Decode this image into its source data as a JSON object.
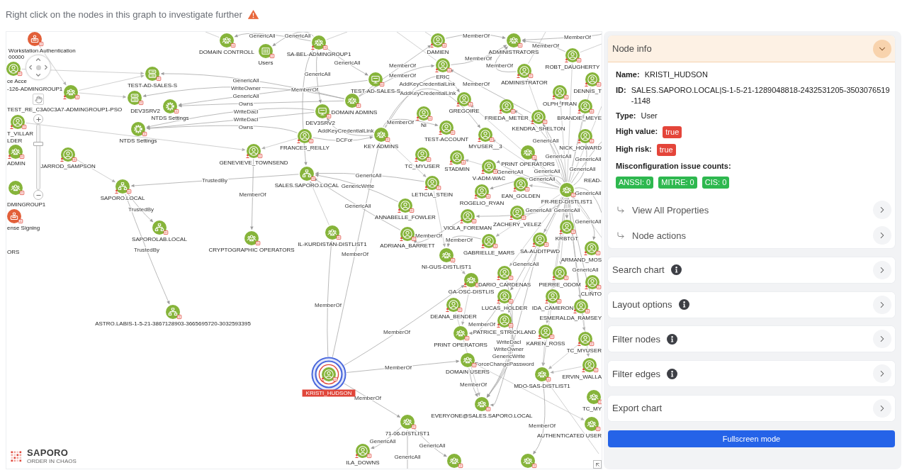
{
  "hint": {
    "text": "Right click on the nodes in this graph to investigate further"
  },
  "graph": {
    "nodes": [
      {
        "label": "Workstation Authentication",
        "kind": "policy",
        "color": "#e2603a",
        "alert": false,
        "selected": false
      },
      {
        "label": "DOMAIN CONTROLL",
        "kind": "group",
        "color": "#86b43a",
        "alert": false,
        "selected": false
      },
      {
        "label": "SA-BEL-ADMINGROUP1",
        "kind": "group",
        "color": "#86b43a",
        "alert": true,
        "selected": false
      },
      {
        "label": "DAMIEN",
        "kind": "user",
        "color": "#86b43a",
        "alert": true,
        "selected": false
      },
      {
        "label": "ADMINISTRATORS",
        "kind": "group",
        "color": "#86b43a",
        "alert": false,
        "selected": false
      },
      {
        "label": "Users",
        "kind": "container",
        "color": "#86b43a",
        "alert": false,
        "selected": false
      },
      {
        "label": "ROBT_DAUGHERTY",
        "kind": "user",
        "color": "#86b43a",
        "alert": true,
        "selected": false
      },
      {
        "label": "ERIC",
        "kind": "user",
        "color": "#86b43a",
        "alert": true,
        "selected": false
      },
      {
        "label": "ce Acce",
        "kind": "user",
        "color": "#86b43a",
        "alert": false,
        "selected": false
      },
      {
        "label": "TEST-AD-SALES-S",
        "kind": "server",
        "color": "#86b43a",
        "alert": false,
        "selected": false
      },
      {
        "label": "ADMINISTRATOR",
        "kind": "user",
        "color": "#86b43a",
        "alert": true,
        "selected": false
      },
      {
        "label": "TEST-AD-SALES-S",
        "kind": "computer",
        "color": "#86b43a",
        "alert": false,
        "selected": false
      },
      {
        "label": "DENNIS_T",
        "kind": "user",
        "color": "#86b43a",
        "alert": true,
        "selected": false
      },
      {
        "label": "OLPH_FRAN",
        "kind": "user",
        "color": "#86b43a",
        "alert": true,
        "selected": false
      },
      {
        "label": "TEST_RE_C3A0C3A7-ADMINGROUP1-PSO",
        "kind": "group",
        "color": "#86b43a",
        "alert": true,
        "selected": false
      },
      {
        "label": "DEV3SRV2",
        "kind": "server",
        "color": "#86b43a",
        "alert": false,
        "selected": false
      },
      {
        "label": "DOMAIN ADMINS",
        "kind": "group",
        "color": "#86b43a",
        "alert": false,
        "selected": false
      },
      {
        "label": "GREGOIRE",
        "kind": "user",
        "color": "#86b43a",
        "alert": true,
        "selected": false
      },
      {
        "label": "NTDS Settings",
        "kind": "settings",
        "color": "#86b43a",
        "alert": false,
        "selected": false
      },
      {
        "label": "FRIEDA_METER",
        "kind": "user",
        "color": "#86b43a",
        "alert": true,
        "selected": false
      },
      {
        "label": "BRANDIE_MEYE",
        "kind": "user",
        "color": "#86b43a",
        "alert": true,
        "selected": false
      },
      {
        "label": "DEV3SRV2",
        "kind": "computer",
        "color": "#86b43a",
        "alert": false,
        "selected": false
      },
      {
        "label": "NI",
        "kind": "user",
        "color": "#86b43a",
        "alert": true,
        "selected": false
      },
      {
        "label": "KENDRA_SHELTON",
        "kind": "user",
        "color": "#86b43a",
        "alert": true,
        "selected": false
      },
      {
        "label": "T_VILLAR",
        "kind": "user",
        "color": "#86b43a",
        "alert": true,
        "selected": false
      },
      {
        "label": "NTDS Settings",
        "kind": "settings",
        "color": "#86b43a",
        "alert": false,
        "selected": false
      },
      {
        "label": "TEST-ACCOUNT",
        "kind": "user",
        "color": "#86b43a",
        "alert": true,
        "selected": false
      },
      {
        "label": "FRANCES_REILLY",
        "kind": "user",
        "color": "#86b43a",
        "alert": true,
        "selected": false
      },
      {
        "label": "KEY ADMINS",
        "kind": "group",
        "color": "#86b43a",
        "alert": false,
        "selected": false
      },
      {
        "label": "MYUSER__3",
        "kind": "user",
        "color": "#86b43a",
        "alert": true,
        "selected": false
      },
      {
        "label": "NICK_HOWARD",
        "kind": "user",
        "color": "#86b43a",
        "alert": true,
        "selected": false
      },
      {
        "label": "ADMIN",
        "kind": "group",
        "color": "#86b43a",
        "alert": true,
        "selected": false
      },
      {
        "label": "GENEVIEVE_TOWNSEND",
        "kind": "user",
        "color": "#86b43a",
        "alert": true,
        "selected": false
      },
      {
        "label": "JARROD_SAMPSON",
        "kind": "user",
        "color": "#86b43a",
        "alert": true,
        "selected": false
      },
      {
        "label": "TC_MYUSER",
        "kind": "user",
        "color": "#86b43a",
        "alert": true,
        "selected": false
      },
      {
        "label": "PRINT OPERATORS",
        "kind": "group",
        "color": "#86b43a",
        "alert": false,
        "selected": false
      },
      {
        "label": "STADMIN",
        "kind": "user",
        "color": "#86b43a",
        "alert": true,
        "selected": false
      },
      {
        "label": "V-ADM-WAC",
        "kind": "user",
        "color": "#86b43a",
        "alert": true,
        "selected": false
      },
      {
        "label": "SALES.SAPORO.LOCAL",
        "kind": "domain",
        "color": "#86b43a",
        "alert": false,
        "selected": false
      },
      {
        "label": "LETICIA_STEIN",
        "kind": "user",
        "color": "#86b43a",
        "alert": true,
        "selected": false
      },
      {
        "label": "SAPORO.LOCAL",
        "kind": "domain",
        "color": "#86b43a",
        "alert": true,
        "selected": false
      },
      {
        "label": "EAN_GOLDEN",
        "kind": "user",
        "color": "#86b43a",
        "alert": true,
        "selected": false
      },
      {
        "label": "DMINGROUP1",
        "kind": "group",
        "color": "#86b43a",
        "alert": false,
        "selected": false
      },
      {
        "label": "ROGELIO_RYAN",
        "kind": "user",
        "color": "#86b43a",
        "alert": true,
        "selected": false
      },
      {
        "label": "FR-RED-DISTLIST1",
        "kind": "group",
        "color": "#86b43a",
        "alert": false,
        "selected": false
      },
      {
        "label": "ANNABELLE_FOWLER",
        "kind": "user",
        "color": "#86b43a",
        "alert": true,
        "selected": false
      },
      {
        "label": "ZACHERY_VELEZ",
        "kind": "user",
        "color": "#86b43a",
        "alert": true,
        "selected": false
      },
      {
        "label": "ense Signing",
        "kind": "policy",
        "color": "#e2603a",
        "alert": false,
        "selected": false
      },
      {
        "label": "VIOLA_FOREMAN",
        "kind": "user",
        "color": "#86b43a",
        "alert": true,
        "selected": false
      },
      {
        "label": "SAPOROLAB.LOCAL",
        "kind": "domain",
        "color": "#86b43a",
        "alert": false,
        "selected": false
      },
      {
        "label": "KRBTGT",
        "kind": "user",
        "color": "#86b43a",
        "alert": true,
        "selected": false
      },
      {
        "label": "IL-KURDISTAN-DISTLIST1",
        "kind": "group",
        "color": "#86b43a",
        "alert": false,
        "selected": false
      },
      {
        "label": "ADRIANA_BARRETT",
        "kind": "user",
        "color": "#86b43a",
        "alert": true,
        "selected": false
      },
      {
        "label": "CRYPTOGRAPHIC OPERATORS",
        "kind": "group",
        "color": "#86b43a",
        "alert": false,
        "selected": false
      },
      {
        "label": "GABRIELLE_MARS",
        "kind": "user",
        "color": "#86b43a",
        "alert": true,
        "selected": false
      },
      {
        "label": "SA-AUDITPWD",
        "kind": "user",
        "color": "#86b43a",
        "alert": true,
        "selected": false
      },
      {
        "label": "ARMAND_MOS",
        "kind": "user",
        "color": "#86b43a",
        "alert": true,
        "selected": false
      },
      {
        "label": "NI-GUS-DISTLIST1",
        "kind": "group",
        "color": "#86b43a",
        "alert": false,
        "selected": false
      },
      {
        "label": "DARIO_CARDENAS",
        "kind": "user",
        "color": "#86b43a",
        "alert": true,
        "selected": false
      },
      {
        "label": "PIERRE_ODOM",
        "kind": "user",
        "color": "#86b43a",
        "alert": true,
        "selected": false
      },
      {
        "label": "GA-OSC-DISTLIS",
        "kind": "group",
        "color": "#86b43a",
        "alert": true,
        "selected": false
      },
      {
        "label": "CLINTO",
        "kind": "user",
        "color": "#86b43a",
        "alert": true,
        "selected": false
      },
      {
        "label": "LUCAS_HOLDER",
        "kind": "user",
        "color": "#86b43a",
        "alert": true,
        "selected": false
      },
      {
        "label": "IDA_CAMERON",
        "kind": "user",
        "color": "#86b43a",
        "alert": true,
        "selected": false
      },
      {
        "label": "DEANA_BENDER",
        "kind": "user",
        "color": "#86b43a",
        "alert": true,
        "selected": false
      },
      {
        "label": "ESMERALDA_RAMSEY",
        "kind": "user",
        "color": "#86b43a",
        "alert": true,
        "selected": false
      },
      {
        "label": "ASTRO.LABIS-1-5-21-3867128903-3665695720-3032593395",
        "kind": "domain",
        "color": "#86b43a",
        "alert": false,
        "selected": false
      },
      {
        "label": "PATRICE_STRICKLAND",
        "kind": "user",
        "color": "#86b43a",
        "alert": true,
        "selected": false
      },
      {
        "label": "PRINT OPERATORS",
        "kind": "group",
        "color": "#86b43a",
        "alert": false,
        "selected": false
      },
      {
        "label": "KAREN_ROSS",
        "kind": "user",
        "color": "#86b43a",
        "alert": true,
        "selected": false
      },
      {
        "label": "TC_MYUSER",
        "kind": "user",
        "color": "#86b43a",
        "alert": true,
        "selected": false
      },
      {
        "label": "DOMAIN USERS",
        "kind": "group",
        "color": "#86b43a",
        "alert": false,
        "selected": false
      },
      {
        "label": "ERVIN_WALLA",
        "kind": "user",
        "color": "#86b43a",
        "alert": true,
        "selected": false
      },
      {
        "label": "MDO-SAS-DISTLIST1",
        "kind": "group",
        "color": "#86b43a",
        "alert": false,
        "selected": false
      },
      {
        "label": "KRISTI_HUDSON",
        "kind": "user",
        "color": "#86b43a",
        "alert": true,
        "selected": true
      },
      {
        "label": "TC_MY",
        "kind": "group",
        "color": "#86b43a",
        "alert": false,
        "selected": false
      },
      {
        "label": "EVERYONE@SALES.SAPORO.LOCAL",
        "kind": "group",
        "color": "#86b43a",
        "alert": false,
        "selected": false
      },
      {
        "label": "71-06-DISTLIST1",
        "kind": "group",
        "color": "#86b43a",
        "alert": false,
        "selected": false
      },
      {
        "label": "AUTHENTICATED USER",
        "kind": "group",
        "color": "#86b43a",
        "alert": false,
        "selected": false
      },
      {
        "label": "ILA_DOWNS",
        "kind": "user",
        "color": "#86b43a",
        "alert": true,
        "selected": false
      },
      {
        "kind": "group",
        "color": "#86b43a",
        "alert": false,
        "selected": false
      },
      {
        "kind": "group",
        "color": "#86b43a",
        "alert": false,
        "selected": false
      }
    ],
    "edges": [
      {
        "label": "GenericAll"
      },
      {
        "label": "GenericAll"
      },
      {
        "label": "MemberOf"
      },
      {
        "label": "MemberOf"
      },
      {
        "label": "MemberOf"
      },
      {
        "label": "MemberOf"
      },
      {
        "label": "GenericAll"
      },
      {
        "label": "MemberOf"
      },
      {
        "label": "MemberOf"
      },
      {
        "label": "GenericAll"
      },
      {
        "label": "MemberOf"
      },
      {
        "label": "GenericAll"
      },
      {
        "label": "AddKeyCredentialLink"
      },
      {
        "label": "MemberOf"
      },
      {
        "label": "WriteOwner"
      },
      {
        "label": "MemberOf"
      },
      {
        "label": "GenericAll"
      },
      {
        "label": "AddKeyCredentialLink"
      },
      {
        "label": "Owns"
      },
      {
        "label": "WriteDacl"
      },
      {
        "label": "WriteDacl"
      },
      {
        "label": "MemberOf"
      },
      {
        "label": "Owns"
      },
      {
        "label": "AddKeyCredentialLink"
      },
      {
        "label": "DCFor"
      },
      {
        "label": "GenericAll"
      },
      {
        "label": "GenericAll"
      },
      {
        "label": "GenericAll"
      },
      {
        "label": "GenericAll"
      },
      {
        "label": "GenericAll"
      },
      {
        "label": "GenericAll"
      },
      {
        "label": "GenericAll"
      },
      {
        "label": "TrustedBy"
      },
      {
        "label": "GenericAll"
      },
      {
        "label": "GenericWrite"
      },
      {
        "label": "MemberOf"
      },
      {
        "label": "GenericAll"
      },
      {
        "label": "GenericAll"
      },
      {
        "label": "TrustedBy"
      },
      {
        "label": "GenericAll"
      },
      {
        "label": "GenericAll"
      },
      {
        "label": "GenericAll"
      },
      {
        "label": "MemberOf"
      },
      {
        "label": "MemberOf"
      },
      {
        "label": "TrustedBy"
      },
      {
        "label": "MemberOf"
      },
      {
        "label": "GenericAll"
      },
      {
        "label": "GenericAll"
      },
      {
        "label": "MemberOf"
      },
      {
        "label": "MemberOf"
      },
      {
        "label": "MemberOf"
      },
      {
        "label": "WriteDacl"
      },
      {
        "label": "WriteOwner"
      },
      {
        "label": "GenericWrite"
      },
      {
        "label": "ForceChangePassword"
      },
      {
        "label": "MemberOf"
      },
      {
        "label": "MemberOf"
      },
      {
        "label": "MemberOf"
      },
      {
        "label": "MemberOf"
      },
      {
        "label": "GenericAll"
      },
      {
        "label": "GenericAll"
      },
      {
        "label": "GenericAll"
      }
    ],
    "cut_labels": [
      {
        "text": "00000"
      },
      {
        "text": "-126-ADMINGROUP1"
      },
      {
        "text": "LDER"
      },
      {
        "text": "READ-"
      },
      {
        "text": "ORS"
      }
    ],
    "zoom": {
      "level": 0.72
    },
    "logo": {
      "name": "SAPORO",
      "tagline": "ORDER IN CHAOS"
    }
  },
  "panel": {
    "node_info": {
      "title": "Node info",
      "expanded": true,
      "fields": [
        {
          "label": "Name:",
          "value": "KRISTI_HUDSON",
          "kind": "text"
        },
        {
          "label": "ID:",
          "value": "SALES.SAPORO.LOCAL|S-1-5-21-1289048818-2432531205-3503076519-1148",
          "kind": "text"
        },
        {
          "label": "Type:",
          "value": "User",
          "kind": "text"
        },
        {
          "label": "High value:",
          "value": "true",
          "kind": "badge"
        },
        {
          "label": "High risk:",
          "value": "true",
          "kind": "badge"
        }
      ],
      "counts_title": "Misconfiguration issue counts:",
      "counts": [
        "ANSSI: 0",
        "MITRE: 0",
        "CIS: 0"
      ],
      "links": [
        "View All Properties",
        "Node actions"
      ]
    },
    "sections": [
      {
        "title": "Search chart",
        "info": true,
        "expanded": false
      },
      {
        "title": "Layout options",
        "info": true,
        "expanded": false
      },
      {
        "title": "Filter nodes",
        "info": true,
        "expanded": false
      },
      {
        "title": "Filter edges",
        "info": true,
        "expanded": false
      },
      {
        "title": "Export chart",
        "info": false,
        "expanded": false
      }
    ],
    "fullscreen_button": "Fullscreen mode"
  }
}
